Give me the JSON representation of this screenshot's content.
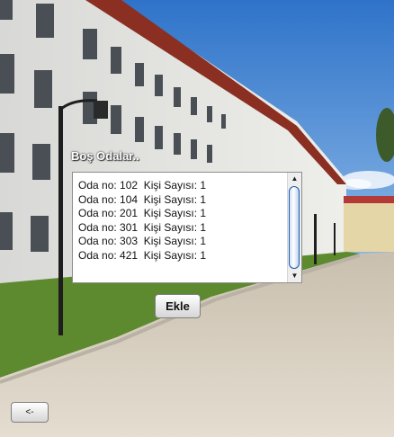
{
  "panel": {
    "title": "Boş Odalar.."
  },
  "rooms": [
    "Oda no: 102  Kişi Sayısı: 1",
    "Oda no: 104  Kişi Sayısı: 1",
    "Oda no: 201  Kişi Sayısı: 1",
    "Oda no: 301  Kişi Sayısı: 1",
    "Oda no: 303  Kişi Sayısı: 1",
    "Oda no: 421  Kişi Sayısı: 1"
  ],
  "scrollbar": {
    "up_glyph": "▲",
    "down_glyph": "▼"
  },
  "buttons": {
    "add_label": "Ekle",
    "back_label": "<-"
  },
  "background": {
    "description_icon": "campus-dormitory-photo",
    "sky": "#3a7fd0",
    "pavement": "#d9d0c0",
    "grass": "#5d8a2e"
  }
}
